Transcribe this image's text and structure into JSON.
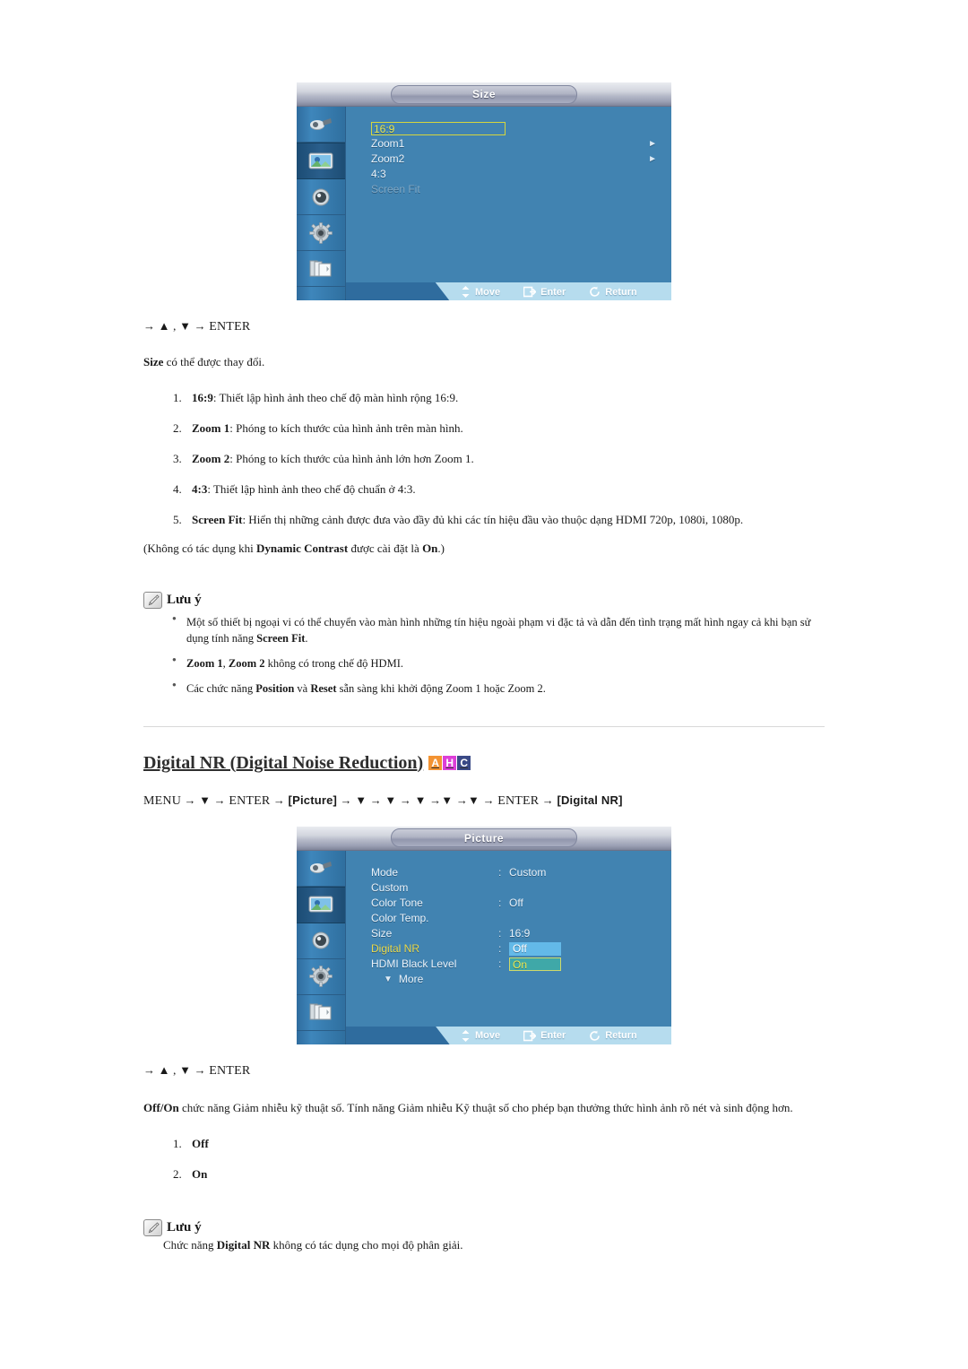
{
  "osd_size": {
    "title": "Size",
    "sidebar_icons": [
      "input-source-icon",
      "picture-icon",
      "sound-icon",
      "setup-gear-icon",
      "multi-control-icon"
    ],
    "selected_sidebar_index": 1,
    "rows": [
      {
        "label": "16:9",
        "selected": true,
        "dim": false,
        "arrow": false
      },
      {
        "label": "Zoom1",
        "selected": false,
        "dim": false,
        "arrow": true
      },
      {
        "label": "Zoom2",
        "selected": false,
        "dim": false,
        "arrow": true
      },
      {
        "label": "4:3",
        "selected": false,
        "dim": false,
        "arrow": false
      },
      {
        "label": "Screen Fit",
        "selected": false,
        "dim": true,
        "arrow": false
      }
    ],
    "footer": {
      "move": "Move",
      "enter": "Enter",
      "return": "Return"
    }
  },
  "osd_picture": {
    "title": "Picture",
    "sidebar_icons": [
      "input-source-icon",
      "picture-icon",
      "sound-icon",
      "setup-gear-icon",
      "multi-control-icon"
    ],
    "selected_sidebar_index": 1,
    "rows": [
      {
        "label": "Mode",
        "colon": ":",
        "value": "Custom"
      },
      {
        "label": "Custom",
        "colon": "",
        "value": ""
      },
      {
        "label": "Color Tone",
        "colon": ":",
        "value": "Off"
      },
      {
        "label": "Color Temp.",
        "colon": "",
        "value": ""
      },
      {
        "label": "Size",
        "colon": ":",
        "value": "16:9"
      },
      {
        "label": "Digital NR",
        "colon": ":",
        "value": "Off",
        "label_highlight": true,
        "value_style": "blue"
      },
      {
        "label": "HDMI Black Level",
        "colon": ":",
        "value": "On",
        "value_style": "teal"
      },
      {
        "label": "More",
        "colon": "",
        "value": "",
        "chevron": true
      }
    ],
    "footer": {
      "move": "Move",
      "enter": "Enter",
      "return": "Return"
    }
  },
  "section_size": {
    "nav_prefix": "→",
    "nav_keys": "▲ , ▼",
    "nav_arrow": "→",
    "nav_enter": "ENTER",
    "lead_bold": "Size",
    "lead_rest": " có thể được thay đổi.",
    "items": [
      {
        "bold": "16:9",
        "rest": ": Thiết lập hình ảnh theo chế độ màn hình rộng 16:9."
      },
      {
        "bold": "Zoom 1",
        "rest": ": Phóng to kích thước của hình ảnh trên màn hình."
      },
      {
        "bold": "Zoom 2",
        "rest": ": Phóng to kích thước của hình ảnh lớn hơn Zoom 1."
      },
      {
        "bold": "4:3",
        "rest": ": Thiết lập hình ảnh theo chế độ chuẩn ở 4:3."
      },
      {
        "bold": "Screen Fit",
        "rest": ": Hiển thị những cảnh được đưa vào đầy đủ khi các tín hiệu đầu vào thuộc dạng HDMI 720p, 1080i, 1080p."
      }
    ],
    "paren_pre": "(Không có tác dụng khi ",
    "paren_bold1": "Dynamic Contrast",
    "paren_mid": " được cài đặt là ",
    "paren_bold2": "On",
    "paren_post": ".)",
    "note_label": "Lưu ý",
    "note_items": [
      {
        "a": "Một số thiết bị ngoại vi có thể chuyển vào màn hình những tín hiệu ngoài phạm vi đặc tả và dẫn đến tình trạng mất hình ngay cả khi bạn sử dụng tính năng ",
        "b": "Screen Fit",
        "c": "."
      },
      {
        "a": "",
        "b": "Zoom 1",
        "c": ", ",
        "b2": "Zoom 2",
        "c2": " không có trong chế độ HDMI."
      },
      {
        "a": "Các chức năng ",
        "b": "Position",
        "c": " và ",
        "b2": "Reset",
        "c2": " sẵn sàng khi khởi động Zoom 1 hoặc Zoom 2."
      }
    ]
  },
  "section_dnr": {
    "heading": "Digital NR (Digital Noise Reduction)",
    "badges": [
      {
        "letter": "A",
        "color": "#F39332"
      },
      {
        "letter": "H",
        "color": "#DD3FD8"
      },
      {
        "letter": "C",
        "color": "#3A4A86"
      }
    ],
    "menu_path": {
      "menu": "MENU",
      "enter": "ENTER",
      "down": "▼",
      "arrow": "→",
      "tag_picture": "[Picture]",
      "tag_digital_nr": "[Digital NR]"
    },
    "nav_prefix": "→",
    "nav_keys": "▲ , ▼",
    "nav_arrow": "→",
    "nav_enter": "ENTER",
    "lead_bold": "Off/On",
    "lead_rest": " chức năng Giảm nhiễu kỹ thuật số. Tính năng Giảm nhiễu Kỹ thuật số cho phép bạn thưởng thức hình ảnh rõ nét và sinh động hơn.",
    "items": [
      {
        "bold": "Off",
        "rest": ""
      },
      {
        "bold": "On",
        "rest": ""
      }
    ],
    "note_label": "Lưu ý",
    "note_pre": "Chức năng ",
    "note_bold": "Digital NR",
    "note_post": " không có tác dụng cho mọi độ phân giải."
  }
}
